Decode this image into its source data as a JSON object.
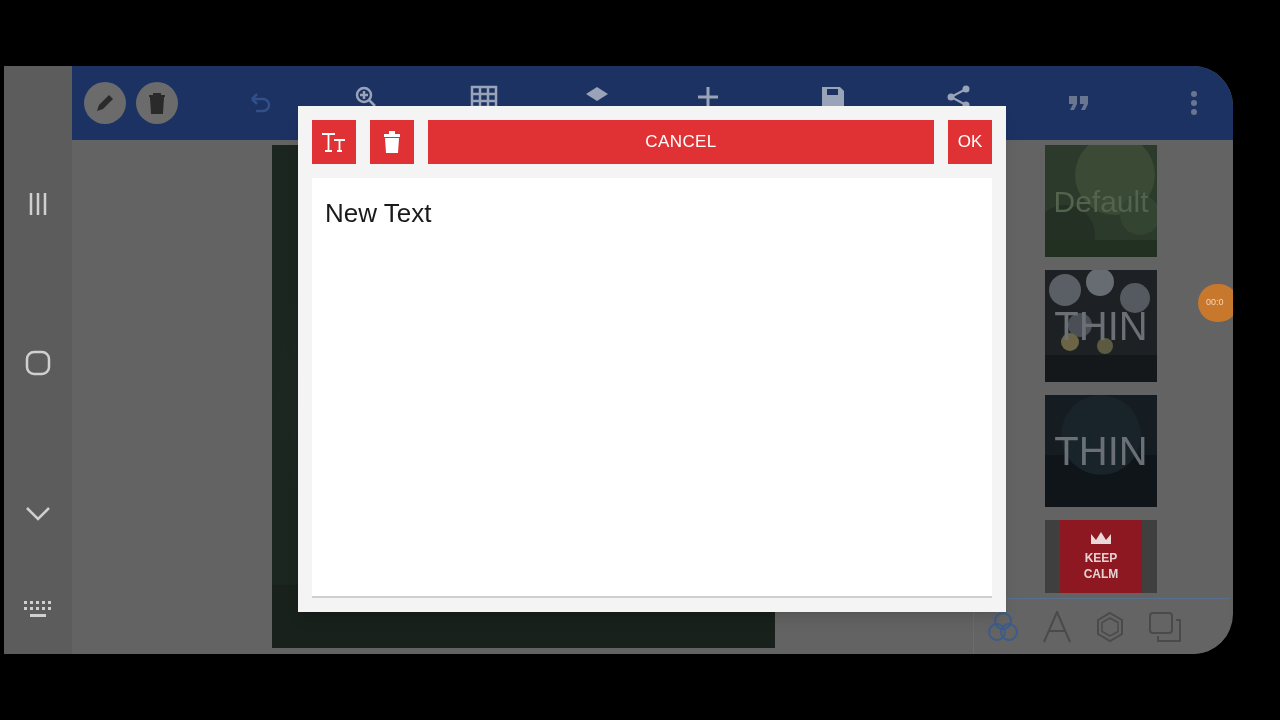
{
  "text_dialog": {
    "cancel_label": "CANCEL",
    "ok_label": "OK",
    "text_value": "New Text"
  },
  "templates": [
    {
      "kind": "default",
      "lines": [
        "Default"
      ]
    },
    {
      "kind": "bokeh",
      "lines": [
        "THIN"
      ]
    },
    {
      "kind": "dark",
      "lines": [
        "THIN"
      ]
    },
    {
      "kind": "keep_calm",
      "lines": [
        "KEEP",
        "CALM"
      ]
    }
  ],
  "recorder_timer": "00:0"
}
